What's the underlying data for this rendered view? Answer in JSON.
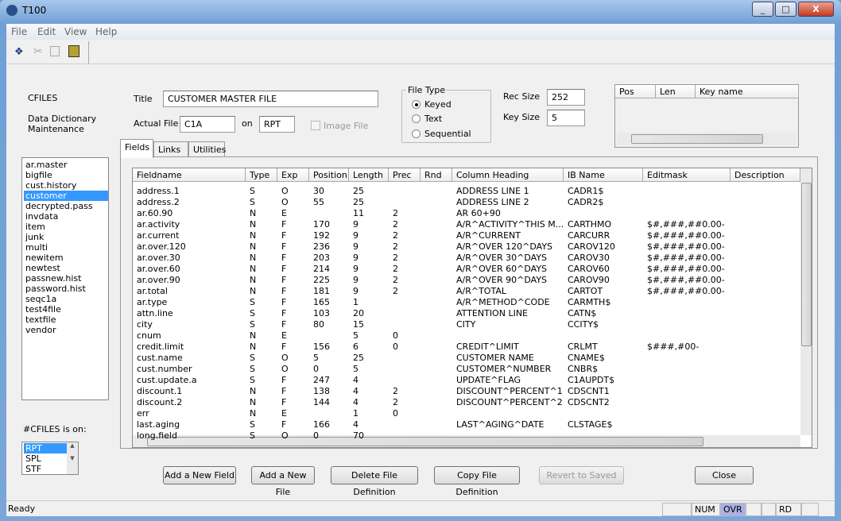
{
  "window": {
    "title": "T100",
    "buttons": [
      "_",
      "□",
      "X"
    ]
  },
  "menu": [
    "File",
    "Edit",
    "View",
    "Help"
  ],
  "toolbar": {
    "icons": [
      "cfiles-logo-icon",
      "cut-icon",
      "copy-icon",
      "paste-icon"
    ]
  },
  "left": {
    "app_name": "CFILES",
    "subtitle": "Data Dictionary Maintenance",
    "files": [
      "ar.master",
      "bigfile",
      "cust.history",
      "customer",
      "decrypted.pass",
      "invdata",
      "item",
      "junk",
      "multi",
      "newitem",
      "newtest",
      "passnew.hist",
      "password.hist",
      "seqc1a",
      "test4file",
      "textfile",
      "vendor"
    ],
    "selected_file": "customer",
    "on_label": "#CFILES is on:",
    "volumes": [
      "RPT",
      "SPL",
      "STF"
    ],
    "selected_volume": "RPT"
  },
  "form": {
    "title_label": "Title",
    "title_value": "CUSTOMER MASTER FILE",
    "actual_file_label": "Actual File",
    "actual_file_value": "C1A",
    "on_label": "on",
    "on_value": "RPT",
    "image_file_label": "Image File",
    "image_file_checked": false,
    "file_type_label": "File Type",
    "file_types": [
      "Keyed",
      "Text",
      "Sequential"
    ],
    "file_type_selected": "Keyed",
    "rec_size_label": "Rec Size",
    "rec_size": "252",
    "key_size_label": "Key Size",
    "key_size": "5",
    "key_columns": [
      "Pos",
      "Len",
      "Key name"
    ]
  },
  "tabs": [
    "Fields",
    "Links",
    "Utilities"
  ],
  "active_tab": "Fields",
  "fields": {
    "columns": [
      "Fieldname",
      "Type",
      "Exp",
      "Position",
      "Length",
      "Prec",
      "Rnd",
      "Column Heading",
      "IB Name",
      "Editmask",
      "Description"
    ],
    "rows": [
      [
        "address.1",
        "S",
        "O",
        "30",
        "25",
        "",
        "",
        "ADDRESS LINE 1",
        "CADR1$",
        "",
        ""
      ],
      [
        "address.2",
        "S",
        "O",
        "55",
        "25",
        "",
        "",
        "ADDRESS LINE 2",
        "CADR2$",
        "",
        ""
      ],
      [
        "ar.60.90",
        "N",
        "E",
        "",
        "11",
        "2",
        "",
        "AR 60+90",
        "",
        "",
        ""
      ],
      [
        "ar.activity",
        "N",
        "F",
        "170",
        "9",
        "2",
        "",
        "A/R^ACTIVITY^THIS M...",
        "CARTHMO",
        "$#,###,##0.00-",
        ""
      ],
      [
        "ar.current",
        "N",
        "F",
        "192",
        "9",
        "2",
        "",
        "A/R^CURRENT",
        "CARCURR",
        "$#,###,##0.00-",
        ""
      ],
      [
        "ar.over.120",
        "N",
        "F",
        "236",
        "9",
        "2",
        "",
        "A/R^OVER 120^DAYS",
        "CAROV120",
        "$#,###,##0.00-",
        ""
      ],
      [
        "ar.over.30",
        "N",
        "F",
        "203",
        "9",
        "2",
        "",
        "A/R^OVER 30^DAYS",
        "CAROV30",
        "$#,###,##0.00-",
        ""
      ],
      [
        "ar.over.60",
        "N",
        "F",
        "214",
        "9",
        "2",
        "",
        "A/R^OVER 60^DAYS",
        "CAROV60",
        "$#,###,##0.00-",
        ""
      ],
      [
        "ar.over.90",
        "N",
        "F",
        "225",
        "9",
        "2",
        "",
        "A/R^OVER 90^DAYS",
        "CAROV90",
        "$#,###,##0.00-",
        ""
      ],
      [
        "ar.total",
        "N",
        "F",
        "181",
        "9",
        "2",
        "",
        "A/R^TOTAL",
        "CARTOT",
        "$#,###,##0.00-",
        ""
      ],
      [
        "ar.type",
        "S",
        "F",
        "165",
        "1",
        "",
        "",
        "A/R^METHOD^CODE",
        "CARMTH$",
        "",
        ""
      ],
      [
        "attn.line",
        "S",
        "F",
        "103",
        "20",
        "",
        "",
        "ATTENTION LINE",
        "CATN$",
        "",
        ""
      ],
      [
        "city",
        "S",
        "F",
        "80",
        "15",
        "",
        "",
        "CITY",
        "CCITY$",
        "",
        ""
      ],
      [
        "cnum",
        "N",
        "E",
        "",
        "5",
        "0",
        "",
        "",
        "",
        "",
        ""
      ],
      [
        "credit.limit",
        "N",
        "F",
        "156",
        "6",
        "0",
        "",
        "CREDIT^LIMIT",
        "CRLMT",
        "$###,#00-",
        ""
      ],
      [
        "cust.name",
        "S",
        "O",
        "5",
        "25",
        "",
        "",
        "CUSTOMER NAME",
        "CNAME$",
        "",
        ""
      ],
      [
        "cust.number",
        "S",
        "O",
        "0",
        "5",
        "",
        "",
        "CUSTOMER^NUMBER",
        "CNBR$",
        "",
        ""
      ],
      [
        "cust.update.a",
        "S",
        "F",
        "247",
        "4",
        "",
        "",
        "UPDATE^FLAG",
        "C1AUPDT$",
        "",
        ""
      ],
      [
        "discount.1",
        "N",
        "F",
        "138",
        "4",
        "2",
        "",
        "DISCOUNT^PERCENT^1",
        "CDSCNT1",
        "",
        ""
      ],
      [
        "discount.2",
        "N",
        "F",
        "144",
        "4",
        "2",
        "",
        "DISCOUNT^PERCENT^2",
        "CDSCNT2",
        "",
        ""
      ],
      [
        "err",
        "N",
        "E",
        "",
        "1",
        "0",
        "",
        "",
        "",
        "",
        ""
      ],
      [
        "last.aging",
        "S",
        "F",
        "166",
        "4",
        "",
        "",
        "LAST^AGING^DATE",
        "CLSTAGE$",
        "",
        ""
      ],
      [
        "long.field",
        "S",
        "O",
        "0",
        "70",
        "",
        "",
        "",
        "",
        "",
        ""
      ]
    ]
  },
  "buttons": {
    "add_field": "Add a New Field",
    "add_file": "Add a New File",
    "delete_def": "Delete File Definition",
    "copy_def": "Copy File Definition",
    "revert": "Revert to Saved",
    "close": "Close"
  },
  "status": {
    "text": "Ready",
    "panels": [
      "",
      "NUM",
      "OVR",
      "",
      "",
      "RD",
      ""
    ],
    "highlight": "OVR",
    "highlight_color": "#aab0e8"
  },
  "colors": {
    "selection": "#3399ff",
    "title_bar": "#6f9fd6"
  }
}
